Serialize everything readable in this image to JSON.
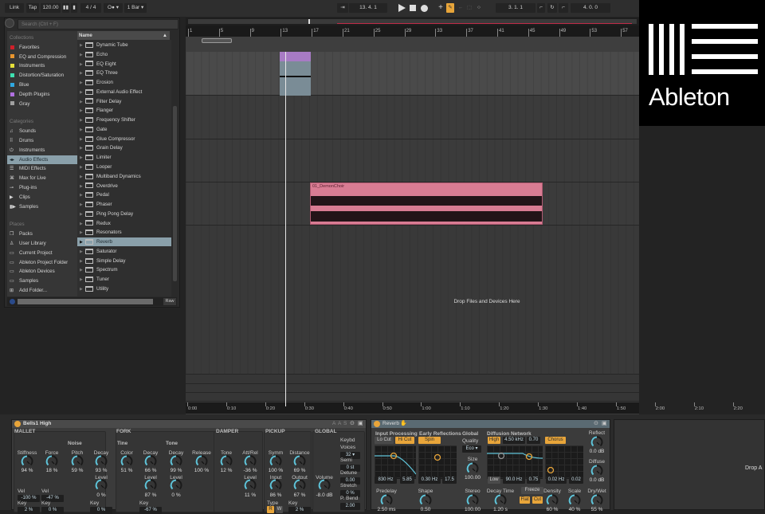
{
  "transport": {
    "link": "Link",
    "tap": "Tap",
    "tempo": "120.00",
    "signature": "4 / 4",
    "metronome": "O●",
    "quantize": "1 Bar",
    "position": "13.  4.  1",
    "loop_start": "3.  1.  1",
    "loop_length": "4.  0.  0",
    "draw_mode_color": "#e8a53a"
  },
  "browser": {
    "search_placeholder": "Search (Ctrl + F)",
    "name_header": "Name",
    "collections_header": "Collections",
    "collections": [
      {
        "label": "Favorites",
        "color": "#d0202a"
      },
      {
        "label": "EQ and Compression",
        "color": "#e8952e"
      },
      {
        "label": "Instruments",
        "color": "#e6e03a"
      },
      {
        "label": "Distortion/Saturation",
        "color": "#3fe0b0"
      },
      {
        "label": "Blue",
        "color": "#2fa8e0"
      },
      {
        "label": "Depth Plugins",
        "color": "#b070e0"
      },
      {
        "label": "Gray",
        "color": "#a0a0a0"
      }
    ],
    "categories_header": "Categories",
    "categories": [
      {
        "label": "Sounds",
        "icon": "note-icon"
      },
      {
        "label": "Drums",
        "icon": "drum-grid-icon"
      },
      {
        "label": "Instruments",
        "icon": "power-icon"
      },
      {
        "label": "Audio Effects",
        "icon": "audio-effect-icon",
        "selected": true
      },
      {
        "label": "MIDI Effects",
        "icon": "midi-effect-icon"
      },
      {
        "label": "Max for Live",
        "icon": "max-icon"
      },
      {
        "label": "Plug-ins",
        "icon": "plug-icon"
      },
      {
        "label": "Clips",
        "icon": "clip-icon"
      },
      {
        "label": "Samples",
        "icon": "sample-icon"
      }
    ],
    "places_header": "Places",
    "places": [
      {
        "label": "Packs",
        "icon": "packs-icon"
      },
      {
        "label": "User Library",
        "icon": "user-icon"
      },
      {
        "label": "Current Project",
        "icon": "folder-icon"
      },
      {
        "label": "Ableton Project Folder",
        "icon": "folder-icon"
      },
      {
        "label": "Ableton Devices",
        "icon": "folder-icon"
      },
      {
        "label": "Samples",
        "icon": "folder-icon"
      },
      {
        "label": "Add Folder...",
        "icon": "add-folder-icon"
      }
    ],
    "items": [
      "Dynamic Tube",
      "Echo",
      "EQ Eight",
      "EQ Three",
      "Erosion",
      "External Audio Effect",
      "Filter Delay",
      "Flanger",
      "Frequency Shifter",
      "Gate",
      "Glue Compressor",
      "Grain Delay",
      "Limiter",
      "Looper",
      "Multiband Dynamics",
      "Overdrive",
      "Pedal",
      "Phaser",
      "Ping Pong Delay",
      "Redux",
      "Resonators",
      "Reverb",
      "Saturator",
      "Simple Delay",
      "Spectrum",
      "Tuner",
      "Utility"
    ],
    "selected_item": "Reverb",
    "raw_button": "Raw"
  },
  "arrangement": {
    "bar_ticks": [
      "1",
      "5",
      "9",
      "13",
      "17",
      "21",
      "25",
      "29",
      "33",
      "37",
      "41",
      "45",
      "49",
      "53",
      "57"
    ],
    "time_ticks": [
      "0:00",
      "0:10",
      "0:20",
      "0:30",
      "0:40",
      "0:50",
      "1:00",
      "1:10",
      "1:20",
      "1:30",
      "1:40",
      "1:50",
      "2:00",
      "2:10",
      "2:20"
    ],
    "audio_clip": {
      "name": "01_DemonChoir",
      "color": "#d97c93"
    },
    "midi_clip_color": "#a77bc4",
    "drop_text": "Drop Files and Devices Here"
  },
  "bells": {
    "title": "Bells1 High",
    "sections": {
      "mallet": "MALLET",
      "fork": "FORK",
      "damper": "DAMPER",
      "pickup": "PICKUP",
      "global": "GLOBAL"
    },
    "subsections": {
      "noise": "Noise",
      "tine": "Tine",
      "tone": "Tone"
    },
    "knobs": [
      {
        "label": "Stiffness",
        "value": "94 %"
      },
      {
        "label": "Force",
        "value": "18 %"
      },
      {
        "label": "Pitch",
        "value": "59 %"
      },
      {
        "label": "Decay",
        "value": "93 %"
      },
      {
        "label": "Color",
        "value": "51 %"
      },
      {
        "label": "Decay",
        "value": "66 %"
      },
      {
        "label": "Decay",
        "value": "99 %"
      },
      {
        "label": "Release",
        "value": "100 %"
      },
      {
        "label": "Tone",
        "value": "12 %"
      },
      {
        "label": "Att/Rel",
        "value": "-36 %"
      },
      {
        "label": "Symm",
        "value": "100 %"
      },
      {
        "label": "Distance",
        "value": "69 %"
      },
      {
        "label": "Level",
        "value": "0 %"
      },
      {
        "label": "Level",
        "value": "87 %"
      },
      {
        "label": "Level",
        "value": "0 %"
      },
      {
        "label": "Level",
        "value": "11 %"
      },
      {
        "label": "Input",
        "value": "86 %"
      },
      {
        "label": "Output",
        "value": "67 %"
      },
      {
        "label": "Volume",
        "value": "-8.0 dB"
      }
    ],
    "fields": [
      {
        "label": "Vel",
        "value": "-100 %"
      },
      {
        "label": "Vel",
        "value": "-47 %"
      },
      {
        "label": "Key",
        "value": "2 %"
      },
      {
        "label": "Key",
        "value": "0 %"
      },
      {
        "label": "Key",
        "value": "0 %"
      },
      {
        "label": "Key",
        "value": "-67 %"
      },
      {
        "label": "Key",
        "value": "2 %"
      }
    ],
    "type_label": "Type",
    "type_r": "R",
    "type_w": "W",
    "keybd": "Keybd",
    "global_fields": [
      {
        "label": "Voices",
        "value": "32 ▾"
      },
      {
        "label": "Semi",
        "value": "0 st"
      },
      {
        "label": "Detune",
        "value": "0.00"
      },
      {
        "label": "Stretch",
        "value": "0 %"
      },
      {
        "label": "P. Bend",
        "value": "2.00"
      }
    ],
    "header_buttons": [
      "A",
      "A",
      "S"
    ]
  },
  "reverb": {
    "title": "Reverb",
    "input_processing": "Input Processing",
    "lo_cut": "Lo Cut",
    "hi_cut": "Hi Cut",
    "input_freq": "830 Hz",
    "input_q": "5.85",
    "early_reflections": "Early Reflections",
    "spin": "Spin",
    "er_rate": "0.30 Hz",
    "er_amount": "17.5",
    "global": "Global",
    "quality": "Quality",
    "quality_value": "Eco ▾",
    "diffusion_network": "Diffusion Network",
    "high": "High",
    "high_freq": "4.50 kHz",
    "high_amount": "0.70",
    "chorus": "Chorus",
    "low": "Low",
    "low_freq": "90.0 Hz",
    "low_amount": "0.75",
    "chorus_rate": "0.02 Hz",
    "chorus_amount": "0.02",
    "freeze": "Freeze",
    "flat": "Flat",
    "cut": "Cut",
    "knobs": [
      {
        "label": "Size",
        "value": "100.00"
      },
      {
        "label": "Reflect",
        "value": "0.0 dB"
      },
      {
        "label": "Diffuse",
        "value": "0.0 dB"
      },
      {
        "label": "Predelay",
        "value": "2.50 ms"
      },
      {
        "label": "Shape",
        "value": "0.50"
      },
      {
        "label": "Stereo",
        "value": "100.00"
      },
      {
        "label": "Decay Time",
        "value": "1.20 s"
      },
      {
        "label": "Density",
        "value": "60 %"
      },
      {
        "label": "Scale",
        "value": "40 %"
      },
      {
        "label": "Dry/Wet",
        "value": "55 %"
      }
    ]
  },
  "right_panel": {
    "drop_text": "Drop A"
  },
  "logo": {
    "text": "Ableton"
  }
}
